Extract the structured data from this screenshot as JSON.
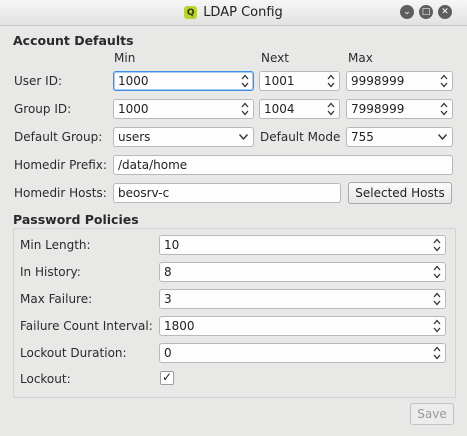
{
  "window": {
    "title": "LDAP Config",
    "app_icon": "Q",
    "buttons": {
      "minimize": "⌄",
      "maximize": "□",
      "close": "✕"
    }
  },
  "account_defaults": {
    "heading": "Account Defaults",
    "columns": {
      "min": "Min",
      "next": "Next",
      "max": "Max"
    },
    "user_id": {
      "label": "User ID:",
      "min": "1000",
      "next": "1001",
      "max": "9998999"
    },
    "group_id": {
      "label": "Group ID:",
      "min": "1000",
      "next": "1004",
      "max": "7998999"
    },
    "default_group": {
      "label": "Default Group:",
      "value": "users"
    },
    "default_mode": {
      "label": "Default Mode",
      "value": "755"
    },
    "homedir_prefix": {
      "label": "Homedir Prefix:",
      "value": "/data/home"
    },
    "homedir_hosts": {
      "label": "Homedir Hosts:",
      "value": "beosrv-c",
      "button": "Selected Hosts"
    }
  },
  "password_policies": {
    "heading": "Password Policies",
    "min_length": {
      "label": "Min Length:",
      "value": "10"
    },
    "in_history": {
      "label": "In History:",
      "value": "8"
    },
    "max_failure": {
      "label": "Max Failure:",
      "value": "3"
    },
    "failure_count_interval": {
      "label": "Failure Count Interval:",
      "value": "1800"
    },
    "lockout_duration": {
      "label": "Lockout Duration:",
      "value": "0"
    },
    "lockout": {
      "label": "Lockout:",
      "checked": true,
      "check_glyph": "✓"
    }
  },
  "footer": {
    "save": "Save",
    "save_enabled": false
  },
  "colors": {
    "accent": "#3d8ee5",
    "background": "#e8e8e7",
    "app_icon": "#b8d432"
  }
}
